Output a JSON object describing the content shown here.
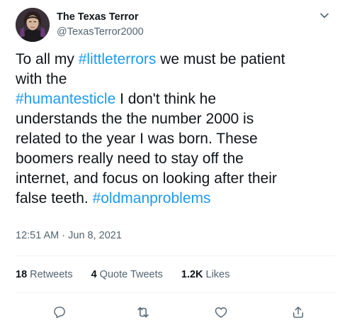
{
  "author": {
    "display_name": "The Texas Terror",
    "handle": "@TexasTerror2000",
    "avatar": "profile-photo"
  },
  "tweet": {
    "lines": [
      [
        {
          "text": "To all my ",
          "type": "text"
        },
        {
          "text": "#littleterrors",
          "type": "hashtag"
        },
        {
          "text": " we must be patient",
          "type": "text"
        }
      ],
      [
        {
          "text": "with the",
          "type": "text"
        }
      ],
      [
        {
          "text": "#humantesticle",
          "type": "hashtag"
        },
        {
          "text": " I don't think he",
          "type": "text"
        }
      ],
      [
        {
          "text": "understands the the number 2000 is",
          "type": "text"
        }
      ],
      [
        {
          "text": "related to the year I was born. These",
          "type": "text"
        }
      ],
      [
        {
          "text": "boomers really need to stay off the",
          "type": "text"
        }
      ],
      [
        {
          "text": "internet, and focus on looking after their",
          "type": "text"
        }
      ],
      [
        {
          "text": "false teeth. ",
          "type": "text"
        },
        {
          "text": "#oldmanproblems",
          "type": "hashtag"
        }
      ]
    ],
    "timestamp": "12:51 AM · Jun 8, 2021"
  },
  "stats": {
    "retweets_count": "18",
    "retweets_label": "Retweets",
    "quotes_count": "4",
    "quotes_label": "Quote Tweets",
    "likes_count": "1.2K",
    "likes_label": "Likes"
  },
  "actions": [
    "reply-icon",
    "retweet-icon",
    "like-icon",
    "share-icon"
  ],
  "colors": {
    "hashtag": "#1d9bf0",
    "secondary_text": "#536471",
    "primary_text": "#0f1419",
    "divider": "#eff3f4"
  }
}
